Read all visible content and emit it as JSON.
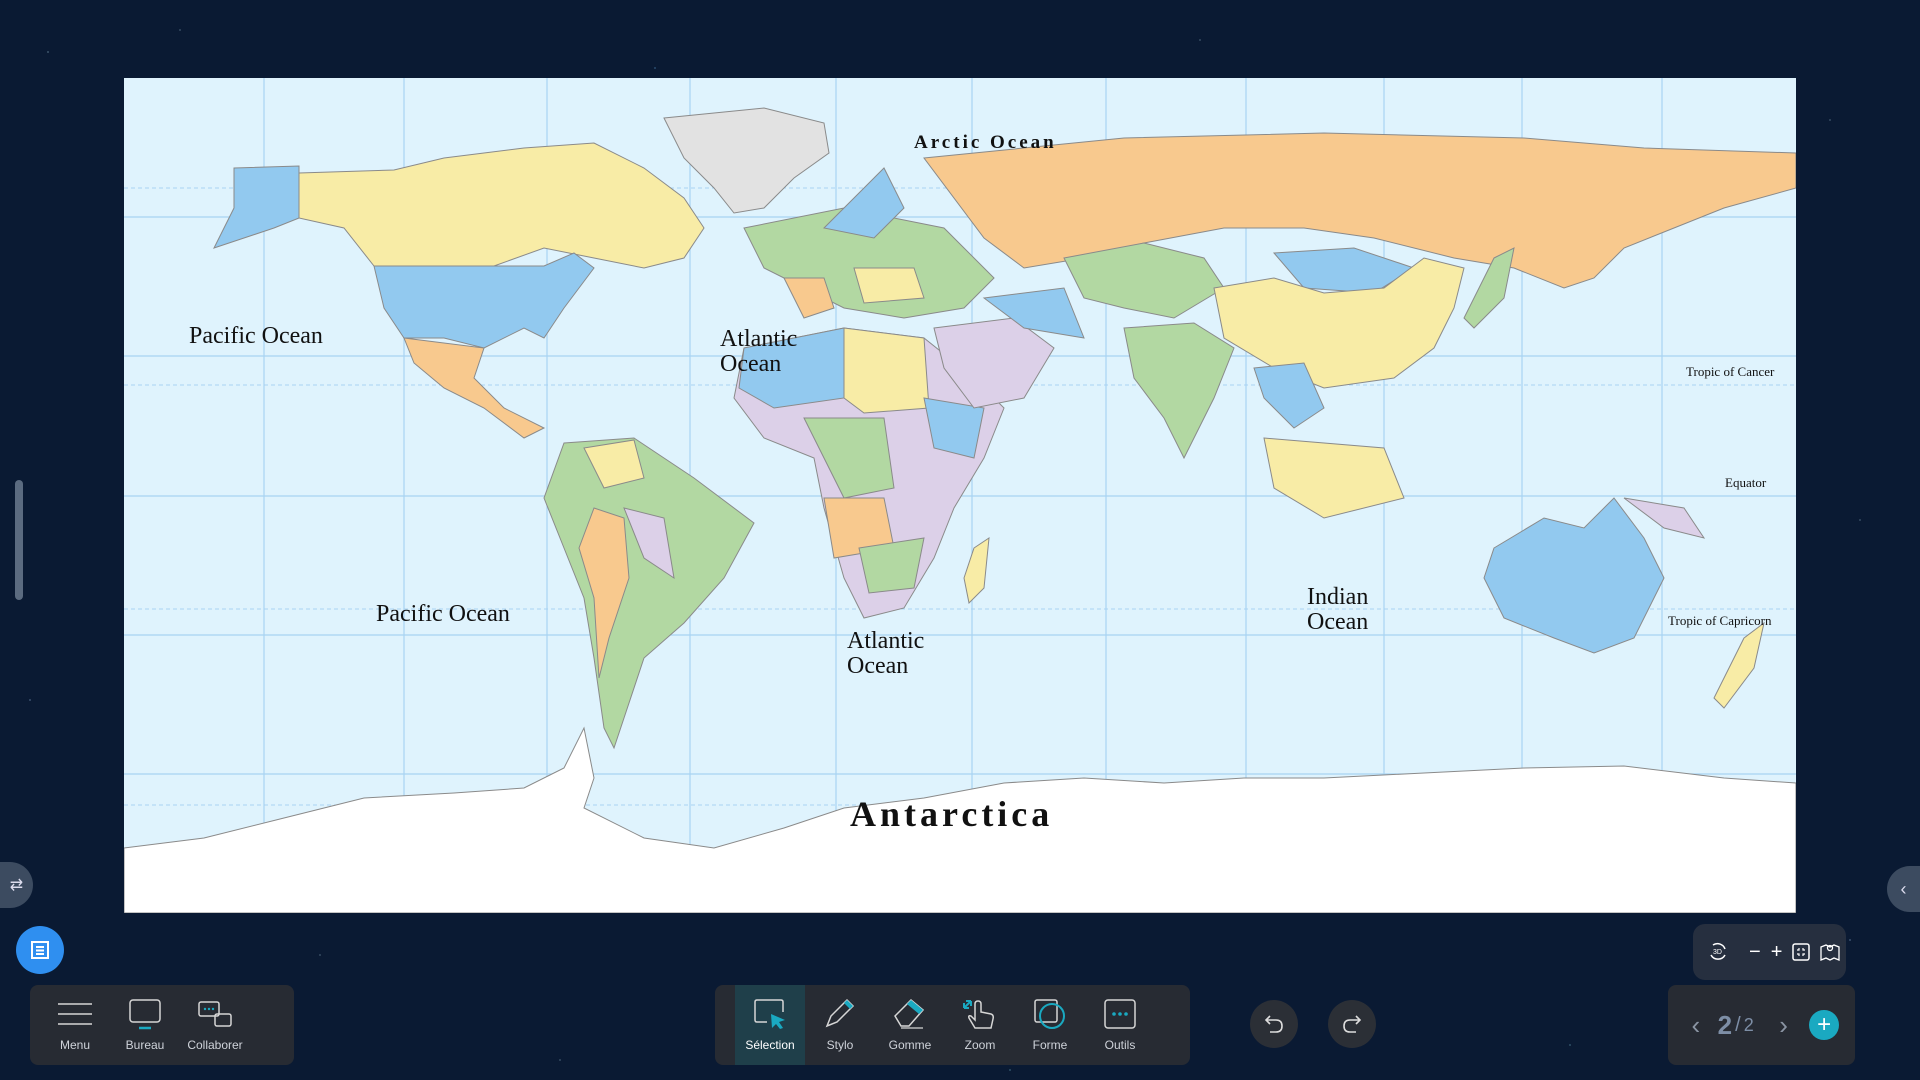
{
  "map": {
    "labels": {
      "arctic": "Arctic Ocean",
      "pacific_north": "Pacific Ocean",
      "atlantic_north_1": "Atlantic",
      "atlantic_north_2": "Ocean",
      "pacific_south": "Pacific Ocean",
      "atlantic_south_1": "Atlantic",
      "atlantic_south_2": "Ocean",
      "indian_1": "Indian",
      "indian_2": "Ocean",
      "antarctica": "Antarctica",
      "tropic_cancer": "Tropic of Cancer",
      "equator": "Equator",
      "tropic_capricorn": "Tropic of Capricorn"
    },
    "colors": {
      "ocean": "#dff3fd",
      "grid": "#9cccf0",
      "blue": "#92c9ef",
      "yellow": "#f8eca6",
      "orange": "#f8c98e",
      "green": "#b2d8a2",
      "purple": "#dcd0e8",
      "grey": "#e2e2e2",
      "ice": "#ffffff"
    }
  },
  "left_toolbar": {
    "items": [
      {
        "label": "Menu",
        "icon": "menu-icon"
      },
      {
        "label": "Bureau",
        "icon": "desktop-icon"
      },
      {
        "label": "Collaborer",
        "icon": "chat-icon"
      }
    ]
  },
  "main_toolbar": {
    "active": "Sélection",
    "items": [
      {
        "label": "Sélection",
        "icon": "selection-icon"
      },
      {
        "label": "Stylo",
        "icon": "pen-icon"
      },
      {
        "label": "Gomme",
        "icon": "eraser-icon"
      },
      {
        "label": "Zoom",
        "icon": "zoom-hand-icon"
      },
      {
        "label": "Forme",
        "icon": "shape-icon"
      },
      {
        "label": "Outils",
        "icon": "more-tools-icon"
      }
    ]
  },
  "view_controls": {
    "rotate_label": "3D",
    "zoom_out": "−",
    "zoom_in": "+"
  },
  "pagination": {
    "current": "2",
    "separator": "/",
    "total": "2",
    "add": "+"
  },
  "accent_color": "#1aa9c1"
}
